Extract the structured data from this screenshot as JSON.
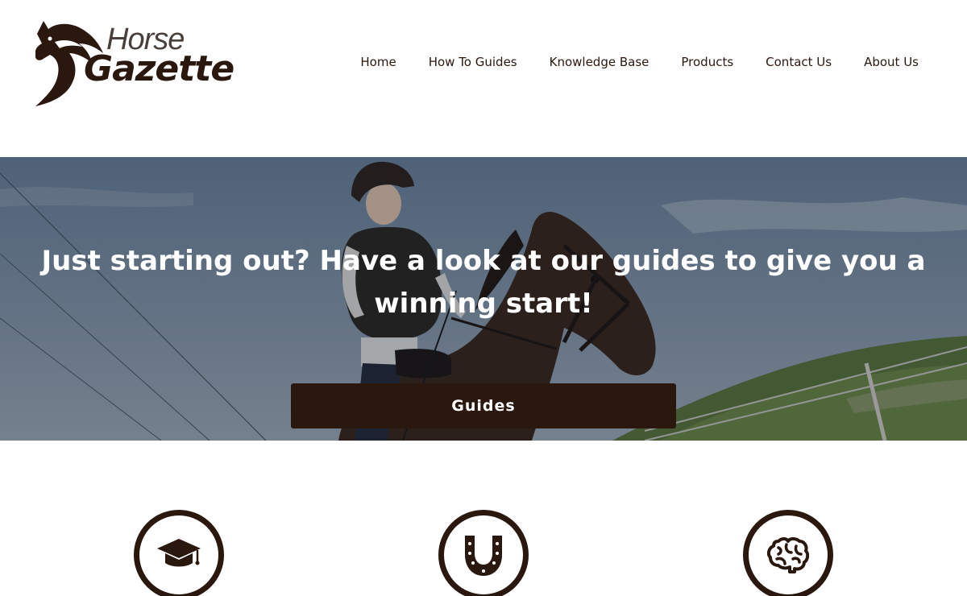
{
  "site": {
    "logo": {
      "word_1": "Horse",
      "word_2": "Gazette",
      "icon": "horse-head-icon"
    },
    "nav": {
      "items": [
        {
          "label": "Home"
        },
        {
          "label": "How To Guides"
        },
        {
          "label": "Knowledge Base"
        },
        {
          "label": "Products"
        },
        {
          "label": "Contact Us"
        },
        {
          "label": "About Us"
        }
      ]
    }
  },
  "hero": {
    "heading": "Just starting out? Have a look at our guides to give you a winning start!",
    "button_label": "Guides",
    "image": "girl-riding-horse-photo"
  },
  "features": {
    "icons": [
      "graduation-cap-icon",
      "horseshoe-icon",
      "brain-icon"
    ]
  },
  "colors": {
    "brand_dark": "#2a170e",
    "text_white": "#ffffff",
    "logo_grey": "#4a403b"
  }
}
